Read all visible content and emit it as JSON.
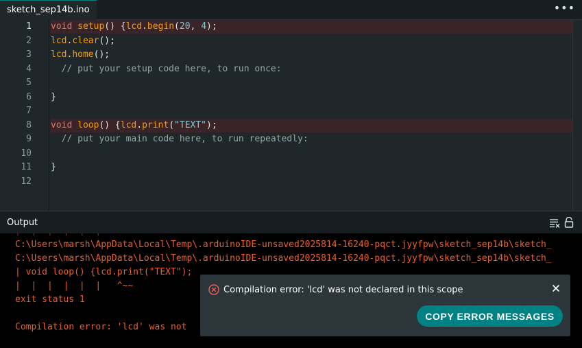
{
  "tab": {
    "title": "sketch_sep14b.ino",
    "more_label": "•••"
  },
  "editor": {
    "line_numbers": [
      "1",
      "2",
      "3",
      "4",
      "5",
      "6",
      "7",
      "8",
      "9",
      "10",
      "11",
      "12"
    ],
    "lines": [
      {
        "error": true,
        "tokens": [
          {
            "t": "kw",
            "v": "void"
          },
          {
            "t": "",
            "v": " "
          },
          {
            "t": "fn",
            "v": "setup"
          },
          {
            "t": "",
            "v": "() {"
          },
          {
            "t": "id",
            "v": "lcd"
          },
          {
            "t": "",
            "v": "."
          },
          {
            "t": "fn",
            "v": "begin"
          },
          {
            "t": "",
            "v": "("
          },
          {
            "t": "num",
            "v": "20"
          },
          {
            "t": "",
            "v": ", "
          },
          {
            "t": "num",
            "v": "4"
          },
          {
            "t": "",
            "v": ");"
          }
        ]
      },
      {
        "error": false,
        "tokens": [
          {
            "t": "id",
            "v": "lcd"
          },
          {
            "t": "",
            "v": "."
          },
          {
            "t": "fn",
            "v": "clear"
          },
          {
            "t": "",
            "v": "();"
          }
        ]
      },
      {
        "error": false,
        "tokens": [
          {
            "t": "id",
            "v": "lcd"
          },
          {
            "t": "",
            "v": "."
          },
          {
            "t": "fn",
            "v": "home"
          },
          {
            "t": "",
            "v": "();"
          }
        ]
      },
      {
        "error": false,
        "tokens": [
          {
            "t": "cm",
            "v": "  // put your setup code here, to run once:"
          }
        ]
      },
      {
        "error": false,
        "tokens": []
      },
      {
        "error": false,
        "tokens": [
          {
            "t": "",
            "v": "}"
          }
        ]
      },
      {
        "error": false,
        "tokens": []
      },
      {
        "error": true,
        "tokens": [
          {
            "t": "kw",
            "v": "void"
          },
          {
            "t": "",
            "v": " "
          },
          {
            "t": "fn",
            "v": "loop"
          },
          {
            "t": "",
            "v": "() {"
          },
          {
            "t": "id",
            "v": "lcd"
          },
          {
            "t": "",
            "v": "."
          },
          {
            "t": "fn",
            "v": "print"
          },
          {
            "t": "",
            "v": "("
          },
          {
            "t": "str",
            "v": "\"TEXT\""
          },
          {
            "t": "",
            "v": ");"
          }
        ]
      },
      {
        "error": false,
        "tokens": [
          {
            "t": "cm",
            "v": "  // put your main code here, to run repeatedly:"
          }
        ]
      },
      {
        "error": false,
        "tokens": []
      },
      {
        "error": false,
        "tokens": [
          {
            "t": "",
            "v": "}"
          }
        ]
      },
      {
        "error": false,
        "tokens": []
      }
    ]
  },
  "output": {
    "title": "Output",
    "lines": [
      {
        "text": "|  |  |  |  |  |",
        "dim": true
      },
      {
        "text": "C:\\Users\\marsh\\AppData\\Local\\Temp\\.arduinoIDE-unsaved2025814-16240-pqct.jyyfpw\\sketch_sep14b\\sketch_",
        "dim": false
      },
      {
        "text": "C:\\Users\\marsh\\AppData\\Local\\Temp\\.arduinoIDE-unsaved2025814-16240-pqct.jyyfpw\\sketch_sep14b\\sketch_",
        "dim": false
      },
      {
        "text": "| void loop() {lcd.print(\"TEXT\");",
        "dim": false
      },
      {
        "text": "|  |  |  |  |  |   ^~~",
        "dim": false
      },
      {
        "text": "exit status 1",
        "dim": false
      },
      {
        "text": "",
        "dim": false
      },
      {
        "text": "Compilation error: 'lcd' was not",
        "dim": false
      }
    ]
  },
  "notification": {
    "message": "Compilation error: 'lcd' was not declared in this scope",
    "button_label": "COPY ERROR MESSAGES"
  },
  "colors": {
    "accent": "#008184",
    "error_text": "#e9602c",
    "error_line_bg": "#3a2428"
  }
}
